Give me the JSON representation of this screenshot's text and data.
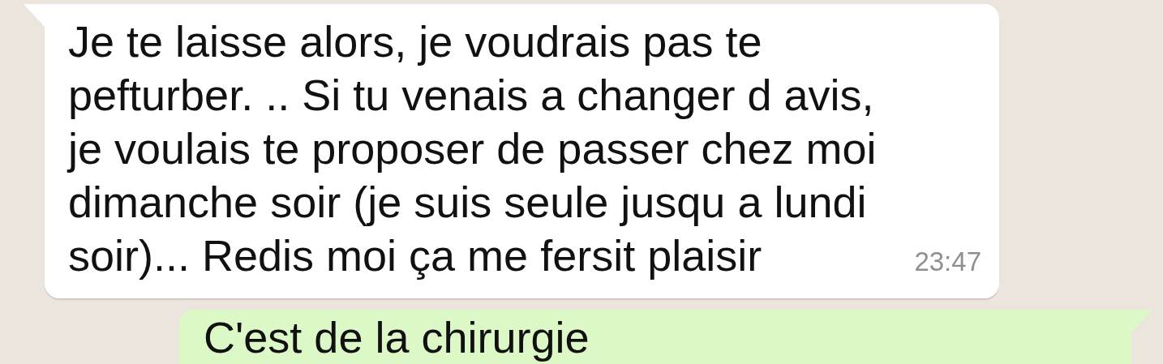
{
  "messages": [
    {
      "kind": "incoming",
      "text": "Je te laisse alors, je voudrais pas te pefturber. .. Si tu venais a changer d avis, je voulais te proposer de passer chez moi dimanche soir (je suis seule jusqu a lundi soir)... Redis moi ça me fersit plaisir",
      "time": "23:47"
    },
    {
      "kind": "outgoing",
      "text": "C'est de la chirurgie"
    }
  ]
}
